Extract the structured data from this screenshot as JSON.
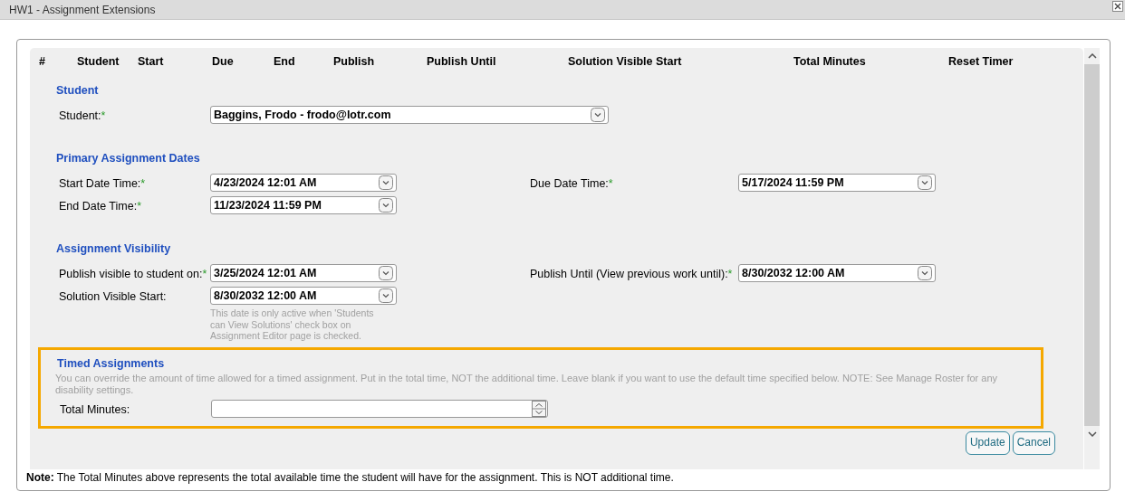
{
  "window": {
    "title": "HW1 - Assignment Extensions"
  },
  "table": {
    "columns": [
      "#",
      "Student",
      "Start",
      "Due",
      "End",
      "Publish",
      "Publish Until",
      "Solution Visible Start",
      "Total Minutes",
      "Reset Timer"
    ]
  },
  "sections": [
    {
      "title": "Student",
      "highlighted": false,
      "rows": [
        [
          {
            "label": "Student:",
            "required_mark": "*",
            "kind": "select",
            "value": "Baggins, Frodo - frodo@lotr.com"
          }
        ]
      ]
    },
    {
      "title": "Primary Assignment Dates",
      "highlighted": false,
      "rows": [
        [
          {
            "label": "Start Date Time:",
            "required_mark": "*",
            "kind": "date",
            "value": "4/23/2024 12:01 AM"
          },
          {
            "label": "Due Date Time:",
            "required_mark": "*",
            "kind": "date",
            "value": "5/17/2024 11:59 PM"
          }
        ],
        [
          {
            "label": "End Date Time:",
            "required_mark": "*",
            "kind": "date",
            "value": "11/23/2024 11:59 PM"
          }
        ]
      ]
    },
    {
      "title": "Assignment Visibility",
      "highlighted": false,
      "rows": [
        [
          {
            "label": "Publish visible to student on:",
            "required_mark": "*",
            "kind": "date",
            "value": "3/25/2024 12:01 AM"
          },
          {
            "label": "Publish Until (View previous work until):",
            "required_mark": "*",
            "kind": "date",
            "value": "8/30/2032 12:00 AM"
          }
        ],
        [
          {
            "label": "Solution Visible Start:",
            "kind": "date",
            "value": "8/30/2032 12:00 AM",
            "hint": "This date is only active when 'Students can View Solutions' check box on Assignment Editor page is checked."
          }
        ]
      ]
    },
    {
      "title": "Timed Assignments",
      "highlighted": true,
      "description": "You can override the amount of time allowed for a timed assignment. Put in the total time, NOT the additional time. Leave blank if you want to use the default time specified below. NOTE: See Manage Roster for any disability settings.",
      "rows": [
        [
          {
            "label": "Total Minutes:",
            "kind": "spin"
          }
        ]
      ]
    }
  ],
  "buttons": [
    "Update",
    "Cancel"
  ],
  "note": "**Note:** The Total Minutes above represents the total available time the student will have for the assignment. This is NOT additional time."
}
